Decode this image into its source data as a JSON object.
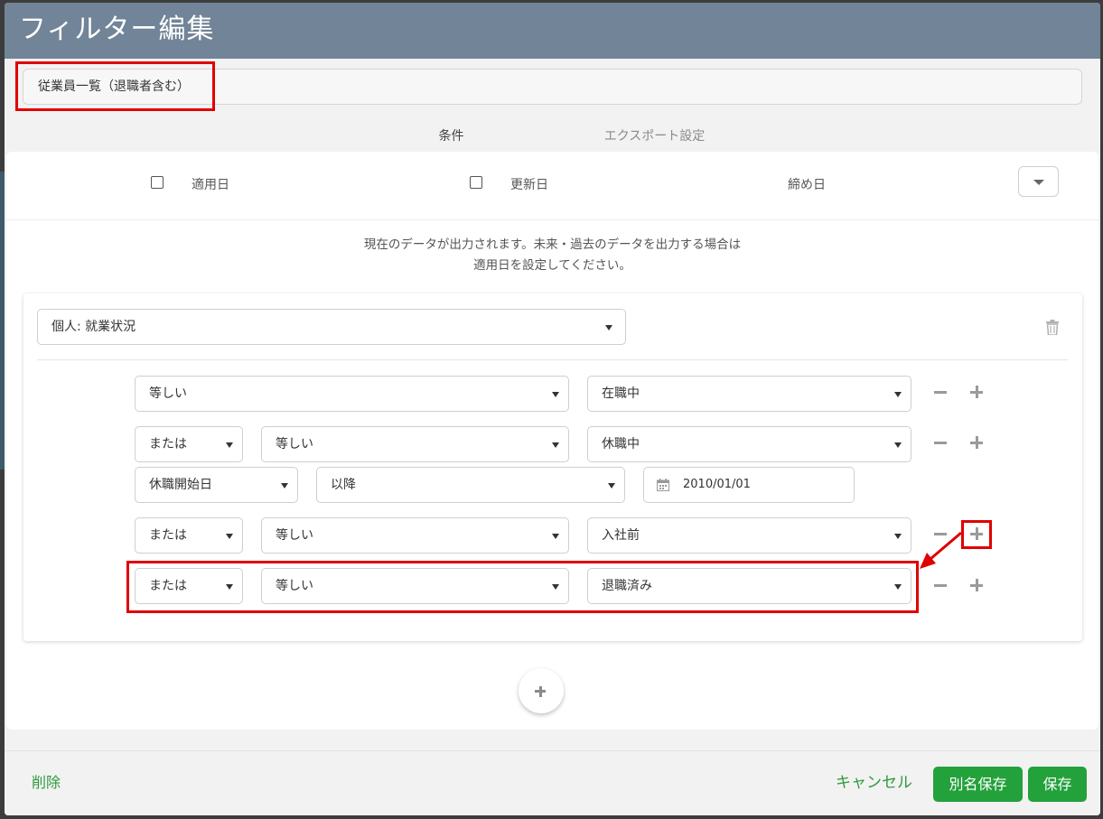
{
  "header": {
    "title": "フィルター編集"
  },
  "filter_name": {
    "value": "従業員一覧（退職者含む）"
  },
  "tabs": [
    {
      "label": "条件",
      "active": true
    },
    {
      "label": "エクスポート設定",
      "active": false
    }
  ],
  "date_options": {
    "apply_date": {
      "label": "適用日",
      "checked": false
    },
    "update_date": {
      "label": "更新日",
      "checked": false
    },
    "closing_date": {
      "label": "締め日"
    }
  },
  "info_text": {
    "line1": "現在のデータが出力されます。未来・過去のデータを出力する場合は",
    "line2": "適用日を設定してください。"
  },
  "condition_group": {
    "field": "個人: 就業状況",
    "rows": [
      {
        "operator": "等しい",
        "value": "在職中"
      },
      {
        "conjunction": "または",
        "operator": "等しい",
        "value": "休職中",
        "sub": {
          "field": "休職開始日",
          "operator": "以降",
          "date": "2010/01/01"
        }
      },
      {
        "conjunction": "または",
        "operator": "等しい",
        "value": "入社前"
      },
      {
        "conjunction": "または",
        "operator": "等しい",
        "value": "退職済み"
      }
    ]
  },
  "footer": {
    "delete": "削除",
    "cancel": "キャンセル",
    "save_as": "別名保存",
    "save": "保存"
  },
  "colors": {
    "header_bg": "#718498",
    "accent_green": "#23a13b",
    "highlight_red": "#e00000"
  }
}
